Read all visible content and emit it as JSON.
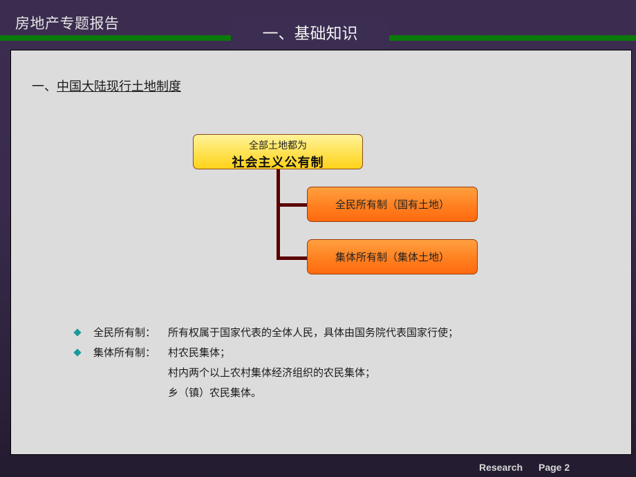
{
  "header": {
    "report_title": "房地产专题报告",
    "section_title": "一、基础知识"
  },
  "content": {
    "subheading_prefix": "一、",
    "subheading_text": "中国大陆现行土地制度",
    "diagram": {
      "root": {
        "line1": "全部土地都为",
        "line2": "社会主义公有制"
      },
      "branches": [
        {
          "label": "全民所有制（国有土地）"
        },
        {
          "label": "集体所有制（集体土地）"
        }
      ]
    },
    "bullets": [
      {
        "label": "全民所有制：",
        "lines": [
          "所有权属于国家代表的全体人民，具体由国务院代表国家行使；"
        ]
      },
      {
        "label": "集体所有制：",
        "lines": [
          "村农民集体；",
          "村内两个以上农村集体经济组织的农民集体；",
          "乡（镇）农民集体。"
        ]
      }
    ],
    "colors": {
      "bullet_diamond": "#1a9a9a",
      "connector": "#5a0000",
      "accent_green": "#0a7a0a"
    }
  },
  "footer": {
    "left": "Research",
    "right": "Page 2"
  }
}
